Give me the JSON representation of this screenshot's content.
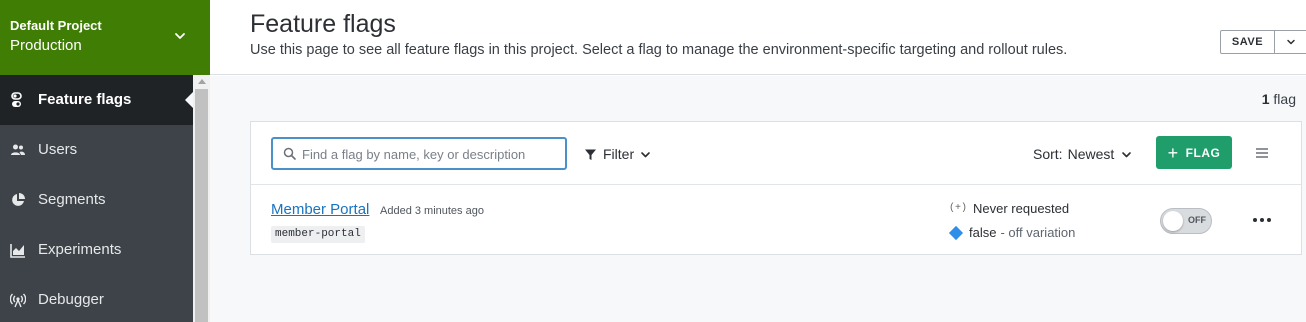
{
  "project": {
    "name": "Default Project",
    "environment": "Production"
  },
  "sidebar": {
    "items": [
      {
        "label": "Feature flags",
        "icon": "toggle-icon",
        "active": true
      },
      {
        "label": "Users",
        "icon": "users-icon",
        "active": false
      },
      {
        "label": "Segments",
        "icon": "pie-chart-icon",
        "active": false
      },
      {
        "label": "Experiments",
        "icon": "area-chart-icon",
        "active": false
      },
      {
        "label": "Debugger",
        "icon": "broadcast-icon",
        "active": false
      }
    ]
  },
  "header": {
    "title": "Feature flags",
    "description": "Use this page to see all feature flags in this project. Select a flag to manage the environment-specific targeting and rollout rules.",
    "save_label": "SAVE"
  },
  "summary": {
    "count": "1",
    "count_unit": "flag"
  },
  "toolbar": {
    "search_placeholder": "Find a flag by name, key or description",
    "search_value": "",
    "filter_label": "Filter",
    "sort_label": "Sort:",
    "sort_value": "Newest",
    "add_flag_label": "FLAG"
  },
  "flags": [
    {
      "name": "Member Portal",
      "added": "Added 3 minutes ago",
      "key": "member-portal",
      "status_prefix": "(+)",
      "status": "Never requested",
      "variation_value": "false",
      "variation_desc": "- off variation",
      "toggle_label": "OFF",
      "enabled": false
    }
  ],
  "colors": {
    "project_bg": "#3f7d04",
    "sidebar_bg": "#3d4349",
    "sidebar_active_bg": "#1f2326",
    "primary_button": "#1f9e6c",
    "link": "#1a73c0",
    "variation_off": "#2f8ee8",
    "search_focus_border": "#4a90c9"
  }
}
